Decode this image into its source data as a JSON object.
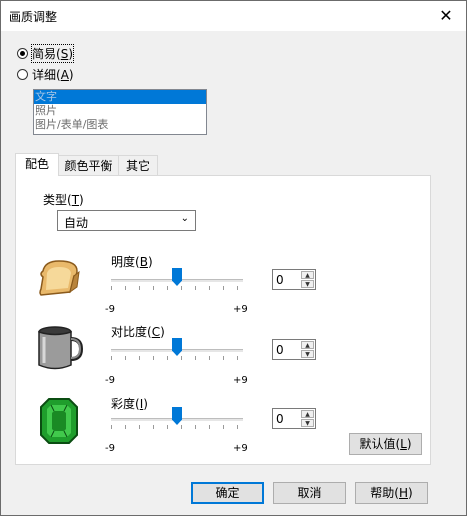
{
  "window": {
    "title": "画质调整"
  },
  "mode": {
    "simple": {
      "label": "简易",
      "key": "S",
      "selected": true
    },
    "detail": {
      "label": "详细",
      "key": "A",
      "selected": false
    }
  },
  "presets": [
    "文字",
    "照片",
    "图片/表单/图表"
  ],
  "tabs": [
    "配色",
    "颜色平衡",
    "其它"
  ],
  "type": {
    "label": "类型",
    "key": "T",
    "value": "自动"
  },
  "brightness": {
    "label": "明度",
    "key": "B",
    "min": "-9",
    "max": "+9",
    "value": "0"
  },
  "contrast": {
    "label": "对比度",
    "key": "C",
    "min": "-9",
    "max": "+9",
    "value": "0"
  },
  "saturation": {
    "label": "彩度",
    "key": "I",
    "min": "-9",
    "max": "+9",
    "value": "0"
  },
  "buttons": {
    "default": {
      "label": "默认值",
      "key": "L"
    },
    "ok": "确定",
    "cancel": "取消",
    "help": {
      "label": "帮助",
      "key": "H"
    }
  },
  "colors": {
    "accent": "#0078d7",
    "dialog_bg": "#f0f0f0"
  },
  "icons": [
    "close-icon",
    "chevron-down-icon",
    "toast-icon",
    "mug-icon",
    "emerald-icon"
  ]
}
